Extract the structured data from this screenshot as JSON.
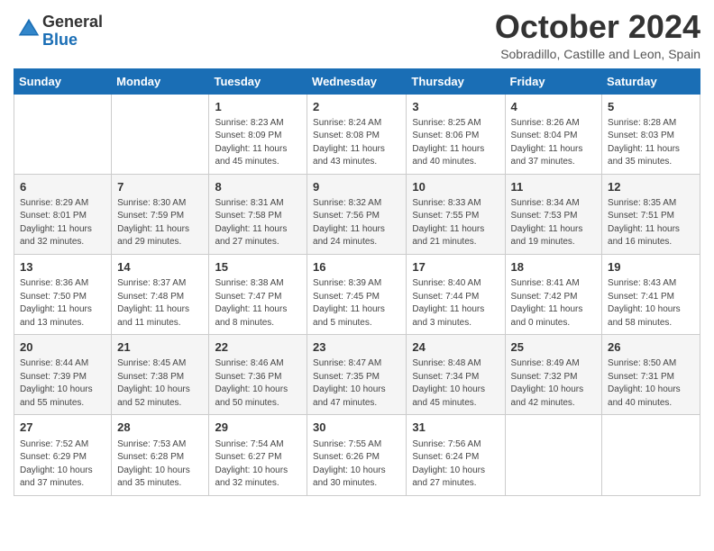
{
  "header": {
    "logo_general": "General",
    "logo_blue": "Blue",
    "month_title": "October 2024",
    "location": "Sobradillo, Castille and Leon, Spain"
  },
  "days_of_week": [
    "Sunday",
    "Monday",
    "Tuesday",
    "Wednesday",
    "Thursday",
    "Friday",
    "Saturday"
  ],
  "weeks": [
    [
      {
        "day": "",
        "info": ""
      },
      {
        "day": "",
        "info": ""
      },
      {
        "day": "1",
        "info": "Sunrise: 8:23 AM\nSunset: 8:09 PM\nDaylight: 11 hours and 45 minutes."
      },
      {
        "day": "2",
        "info": "Sunrise: 8:24 AM\nSunset: 8:08 PM\nDaylight: 11 hours and 43 minutes."
      },
      {
        "day": "3",
        "info": "Sunrise: 8:25 AM\nSunset: 8:06 PM\nDaylight: 11 hours and 40 minutes."
      },
      {
        "day": "4",
        "info": "Sunrise: 8:26 AM\nSunset: 8:04 PM\nDaylight: 11 hours and 37 minutes."
      },
      {
        "day": "5",
        "info": "Sunrise: 8:28 AM\nSunset: 8:03 PM\nDaylight: 11 hours and 35 minutes."
      }
    ],
    [
      {
        "day": "6",
        "info": "Sunrise: 8:29 AM\nSunset: 8:01 PM\nDaylight: 11 hours and 32 minutes."
      },
      {
        "day": "7",
        "info": "Sunrise: 8:30 AM\nSunset: 7:59 PM\nDaylight: 11 hours and 29 minutes."
      },
      {
        "day": "8",
        "info": "Sunrise: 8:31 AM\nSunset: 7:58 PM\nDaylight: 11 hours and 27 minutes."
      },
      {
        "day": "9",
        "info": "Sunrise: 8:32 AM\nSunset: 7:56 PM\nDaylight: 11 hours and 24 minutes."
      },
      {
        "day": "10",
        "info": "Sunrise: 8:33 AM\nSunset: 7:55 PM\nDaylight: 11 hours and 21 minutes."
      },
      {
        "day": "11",
        "info": "Sunrise: 8:34 AM\nSunset: 7:53 PM\nDaylight: 11 hours and 19 minutes."
      },
      {
        "day": "12",
        "info": "Sunrise: 8:35 AM\nSunset: 7:51 PM\nDaylight: 11 hours and 16 minutes."
      }
    ],
    [
      {
        "day": "13",
        "info": "Sunrise: 8:36 AM\nSunset: 7:50 PM\nDaylight: 11 hours and 13 minutes."
      },
      {
        "day": "14",
        "info": "Sunrise: 8:37 AM\nSunset: 7:48 PM\nDaylight: 11 hours and 11 minutes."
      },
      {
        "day": "15",
        "info": "Sunrise: 8:38 AM\nSunset: 7:47 PM\nDaylight: 11 hours and 8 minutes."
      },
      {
        "day": "16",
        "info": "Sunrise: 8:39 AM\nSunset: 7:45 PM\nDaylight: 11 hours and 5 minutes."
      },
      {
        "day": "17",
        "info": "Sunrise: 8:40 AM\nSunset: 7:44 PM\nDaylight: 11 hours and 3 minutes."
      },
      {
        "day": "18",
        "info": "Sunrise: 8:41 AM\nSunset: 7:42 PM\nDaylight: 11 hours and 0 minutes."
      },
      {
        "day": "19",
        "info": "Sunrise: 8:43 AM\nSunset: 7:41 PM\nDaylight: 10 hours and 58 minutes."
      }
    ],
    [
      {
        "day": "20",
        "info": "Sunrise: 8:44 AM\nSunset: 7:39 PM\nDaylight: 10 hours and 55 minutes."
      },
      {
        "day": "21",
        "info": "Sunrise: 8:45 AM\nSunset: 7:38 PM\nDaylight: 10 hours and 52 minutes."
      },
      {
        "day": "22",
        "info": "Sunrise: 8:46 AM\nSunset: 7:36 PM\nDaylight: 10 hours and 50 minutes."
      },
      {
        "day": "23",
        "info": "Sunrise: 8:47 AM\nSunset: 7:35 PM\nDaylight: 10 hours and 47 minutes."
      },
      {
        "day": "24",
        "info": "Sunrise: 8:48 AM\nSunset: 7:34 PM\nDaylight: 10 hours and 45 minutes."
      },
      {
        "day": "25",
        "info": "Sunrise: 8:49 AM\nSunset: 7:32 PM\nDaylight: 10 hours and 42 minutes."
      },
      {
        "day": "26",
        "info": "Sunrise: 8:50 AM\nSunset: 7:31 PM\nDaylight: 10 hours and 40 minutes."
      }
    ],
    [
      {
        "day": "27",
        "info": "Sunrise: 7:52 AM\nSunset: 6:29 PM\nDaylight: 10 hours and 37 minutes."
      },
      {
        "day": "28",
        "info": "Sunrise: 7:53 AM\nSunset: 6:28 PM\nDaylight: 10 hours and 35 minutes."
      },
      {
        "day": "29",
        "info": "Sunrise: 7:54 AM\nSunset: 6:27 PM\nDaylight: 10 hours and 32 minutes."
      },
      {
        "day": "30",
        "info": "Sunrise: 7:55 AM\nSunset: 6:26 PM\nDaylight: 10 hours and 30 minutes."
      },
      {
        "day": "31",
        "info": "Sunrise: 7:56 AM\nSunset: 6:24 PM\nDaylight: 10 hours and 27 minutes."
      },
      {
        "day": "",
        "info": ""
      },
      {
        "day": "",
        "info": ""
      }
    ]
  ]
}
